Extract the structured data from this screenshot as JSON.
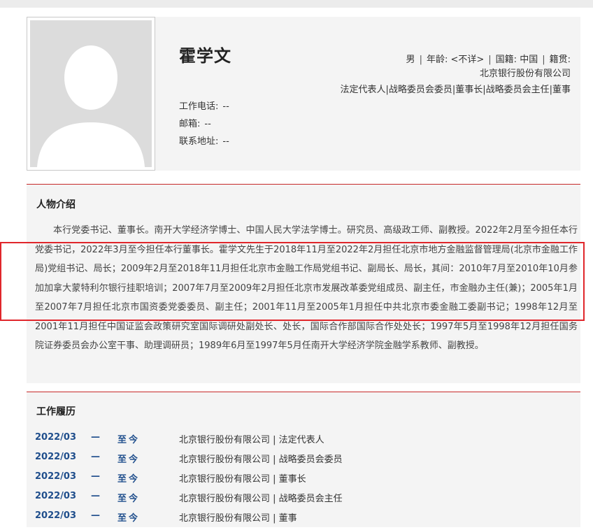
{
  "profile": {
    "name": "霍学文",
    "gender": "男",
    "age_label": "年龄:",
    "age_value": "<不详>",
    "nationality_label": "国籍:",
    "nationality_value": "中国",
    "origin_label": "籍贯:",
    "company": "北京银行股份有限公司",
    "roles": "法定代表人|战略委员会委员|董事长|战略委员会主任|董事",
    "contacts": [
      {
        "label": "工作电话:",
        "value": "--"
      },
      {
        "label": "邮箱:",
        "value": "--"
      },
      {
        "label": "联系地址:",
        "value": "--"
      }
    ]
  },
  "bio": {
    "title": "人物介绍",
    "text": "本行党委书记、董事长。南开大学经济学博士、中国人民大学法学博士。研究员、高级政工师、副教授。2022年2月至今担任本行党委书记，2022年3月至今担任本行董事长。霍学文先生于2018年11月至2022年2月担任北京市地方金融监督管理局(北京市金融工作局)党组书记、局长；2009年2月至2018年11月担任北京市金融工作局党组书记、副局长、局长，其间：2010年7月至2010年10月参加加拿大蒙特利尔银行挂职培训；2007年7月至2009年2月担任北京市发展改革委党组成员、副主任，市金融办主任(兼)；2005年1月至2007年7月担任北京市国资委党委委员、副主任；2001年11月至2005年1月担任中共北京市委金融工委副书记；1998年12月至2001年11月担任中国证监会政策研究室国际调研处副处长、处长，国际合作部国际合作处处长；1997年5月至1998年12月担任国务院证券委员会办公室干事、助理调研员；1989年6月至1997年5月任南开大学经济学院金融学系教师、副教授。"
  },
  "work": {
    "title": "工作履历",
    "rows": [
      {
        "start": "2022/03",
        "dash": "—",
        "end": "至今",
        "org": "北京银行股份有限公司 | 法定代表人"
      },
      {
        "start": "2022/03",
        "dash": "—",
        "end": "至今",
        "org": "北京银行股份有限公司 | 战略委员会委员"
      },
      {
        "start": "2022/03",
        "dash": "—",
        "end": "至今",
        "org": "北京银行股份有限公司 | 董事长"
      },
      {
        "start": "2022/03",
        "dash": "—",
        "end": "至今",
        "org": "北京银行股份有限公司 | 战略委员会主任"
      },
      {
        "start": "2022/03",
        "dash": "—",
        "end": "至今",
        "org": "北京银行股份有限公司 | 董事"
      }
    ]
  }
}
